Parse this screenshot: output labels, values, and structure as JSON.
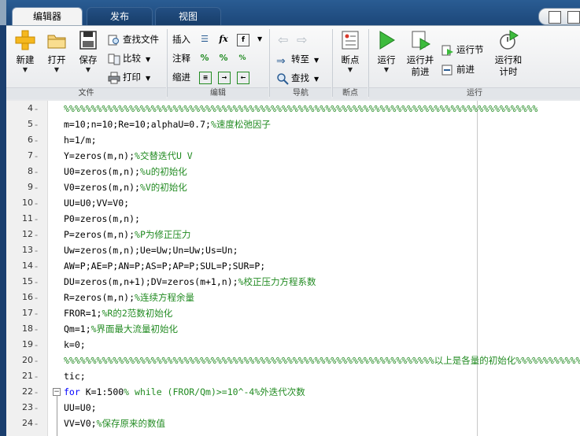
{
  "tabs": [
    {
      "label": "编辑器",
      "active": true
    },
    {
      "label": "发布",
      "active": false
    },
    {
      "label": "视图",
      "active": false
    }
  ],
  "ribbon": {
    "file": {
      "label": "文件",
      "new": "新建",
      "open": "打开",
      "save": "保存",
      "find_files": "查找文件",
      "compare": "比较",
      "print": "打印"
    },
    "edit": {
      "label": "编辑",
      "insert": "插入",
      "comment": "注释",
      "indent": "缩进",
      "fx": "fx"
    },
    "navigate": {
      "label": "导航",
      "goto": "转至",
      "find": "查找"
    },
    "breakpoints": {
      "label": "断点",
      "breakpoints_button": "断点"
    },
    "run": {
      "label": "运行",
      "run": "运行",
      "run_advance_line1": "运行并",
      "run_advance_line2": "前进",
      "run_section": "运行节",
      "advance": "前进",
      "run_time_line1": "运行和",
      "run_time_line2": "计时"
    }
  },
  "editor": {
    "lines": [
      {
        "n": "4",
        "parts": [
          [
            "cm",
            "%%%%%%%%%%%%%%%%%%%%%%%%%%%%%%%%%%%%%%%%%%%%%%%%%%%%%%%%%%%%%%%%%%%%%%%%%%%%%%%%%%%%%%%"
          ]
        ]
      },
      {
        "n": "5",
        "parts": [
          [
            "",
            "m=10;n=10;Re=10;alphaU=0.7;"
          ],
          [
            "cm",
            "%速度松弛因子"
          ]
        ]
      },
      {
        "n": "6",
        "parts": [
          [
            "",
            "h=1/m;"
          ]
        ]
      },
      {
        "n": "7",
        "parts": [
          [
            "",
            "Y=zeros(m,n);"
          ],
          [
            "cm",
            "%交替迭代U V"
          ]
        ]
      },
      {
        "n": "8",
        "parts": [
          [
            "",
            "U0=zeros(m,n);"
          ],
          [
            "cm",
            "%u的初始化"
          ]
        ]
      },
      {
        "n": "9",
        "parts": [
          [
            "",
            "V0=zeros(m,n);"
          ],
          [
            "cm",
            "%V的初始化"
          ]
        ]
      },
      {
        "n": "10",
        "parts": [
          [
            "",
            "UU=U0;VV=V0;"
          ]
        ]
      },
      {
        "n": "11",
        "parts": [
          [
            "",
            "P0=zeros(m,n);"
          ]
        ]
      },
      {
        "n": "12",
        "parts": [
          [
            "",
            "P=zeros(m,n);"
          ],
          [
            "cm",
            "%P为修正压力"
          ]
        ]
      },
      {
        "n": "13",
        "parts": [
          [
            "",
            "Uw=zeros(m,n);Ue=Uw;Un=Uw;Us=Un;"
          ]
        ]
      },
      {
        "n": "14",
        "parts": [
          [
            "",
            "AW=P;AE=P;AN=P;AS=P;AP=P;SUL=P;SUR=P;"
          ]
        ]
      },
      {
        "n": "15",
        "parts": [
          [
            "",
            "DU=zeros(m,n+1);DV=zeros(m+1,n);"
          ],
          [
            "cm",
            "%校正压力方程系数"
          ]
        ]
      },
      {
        "n": "16",
        "parts": [
          [
            "",
            "R=zeros(m,n);"
          ],
          [
            "cm",
            "%连续方程余量"
          ]
        ]
      },
      {
        "n": "17",
        "parts": [
          [
            "",
            "FROR=1;"
          ],
          [
            "cm",
            "%R的2范数初始化"
          ]
        ]
      },
      {
        "n": "18",
        "parts": [
          [
            "",
            "Qm=1;"
          ],
          [
            "cm",
            "%界面最大流量初始化"
          ]
        ]
      },
      {
        "n": "19",
        "parts": [
          [
            "",
            "k=0;"
          ]
        ]
      },
      {
        "n": "20",
        "parts": [
          [
            "cm",
            "%%%%%%%%%%%%%%%%%%%%%%%%%%%%%%%%%%%%%%%%%%%%%%%%%%%%%%%%%%%%%%%%%%%%以上是各量的初始化%%%%%%%%%%%%%%%%%%%%%"
          ]
        ]
      },
      {
        "n": "21",
        "parts": [
          [
            "",
            "tic;"
          ]
        ]
      },
      {
        "n": "22",
        "fold": true,
        "parts": [
          [
            "kw",
            "for"
          ],
          [
            "",
            " K=1:500"
          ],
          [
            "cm",
            "% while (FROR/Qm)>=10^-4%外迭代次数"
          ]
        ]
      },
      {
        "n": "23",
        "parts": [
          [
            "",
            "UU=U0;"
          ]
        ]
      },
      {
        "n": "24",
        "parts": [
          [
            "",
            "VV=V0;"
          ],
          [
            "cm",
            "%保存原来的数值"
          ]
        ]
      }
    ]
  }
}
